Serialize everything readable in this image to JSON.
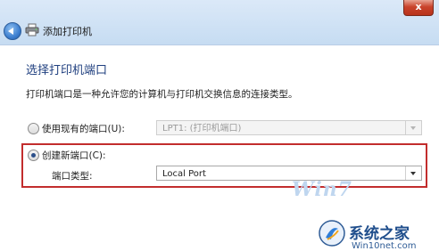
{
  "window": {
    "title": "添加打印机",
    "close_glyph": "x"
  },
  "page": {
    "heading": "选择打印机端口",
    "description": "打印机端口是一种允许您的计算机与打印机交换信息的连接类型。"
  },
  "options": {
    "existing": {
      "label": "使用现有的端口(U):",
      "selected": false,
      "value": "LPT1: (打印机端口)",
      "enabled": false
    },
    "create": {
      "label": "创建新端口(C):",
      "selected": true,
      "type_label": "端口类型:",
      "type_value": "Local Port"
    }
  },
  "watermark": {
    "win7": "Win7",
    "brand": "系统之家",
    "url": "Win10net.com"
  },
  "colors": {
    "highlight": "#c22d2d",
    "heading": "#1f3f7f",
    "titlebar": "#c6dcf2"
  },
  "icons": [
    "back-arrow-icon",
    "printer-icon",
    "close-icon",
    "chevron-down-icon"
  ]
}
